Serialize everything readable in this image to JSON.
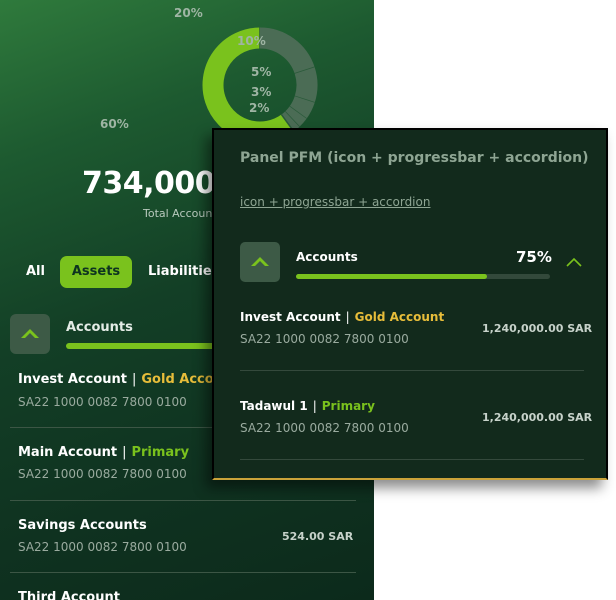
{
  "summary": {
    "percent_labels": [
      "20%",
      "10%",
      "5%",
      "3%",
      "2%",
      "60%"
    ],
    "total_value": "734,000.0",
    "total_label": "Total Accoun"
  },
  "chart_data": {
    "type": "pie",
    "categories": [
      "",
      "",
      "",
      "",
      "",
      ""
    ],
    "values": [
      60,
      20,
      10,
      5,
      3,
      2
    ],
    "colors": [
      "#7ac21d",
      "#4b6c55",
      "#4b6c55",
      "#4b6c55",
      "#4b6c55",
      "#4b6c55"
    ]
  },
  "tabs": [
    {
      "label": "All",
      "selected": false
    },
    {
      "label": "Assets",
      "selected": true
    },
    {
      "label": "Liabilities",
      "selected": false
    }
  ],
  "background_list": {
    "accordion_title": "Accounts",
    "accounts": [
      {
        "name": "Invest Account",
        "tag": "Gold Accoun",
        "iban": "SA22 1000 0082 7800 0100",
        "amount": ""
      },
      {
        "name": "Main Account",
        "tag": "Primary",
        "iban": "SA22 1000 0082 7800 0100",
        "amount": ""
      },
      {
        "name": "Savings Accounts",
        "tag": "",
        "iban": "SA22 1000 0082 7800 0100",
        "amount": "524.00 SAR"
      },
      {
        "name": "Third Account",
        "tag": "",
        "iban": "",
        "amount": ""
      }
    ],
    "separator": "|"
  },
  "panel": {
    "title": "Panel PFM (icon + progressbar + accordion)",
    "subtitle": "icon + progressbar + accordion",
    "accordion": {
      "title": "Accounts",
      "percent": "75%",
      "progress": 0.75,
      "expanded": true
    },
    "accounts": [
      {
        "name": "Invest Account",
        "tag": "Gold Account",
        "iban": "SA22 1000 0082 7800 0100",
        "amount": "1,240,000.00 SAR"
      },
      {
        "name": "Tadawul 1",
        "tag": "Primary",
        "iban": "SA22 1000 0082 7800 0100",
        "amount": "1,240,000.00 SAR"
      }
    ],
    "separator": "|"
  },
  "colors": {
    "accent": "#7ac21d",
    "gold": "#e7bd3a"
  }
}
